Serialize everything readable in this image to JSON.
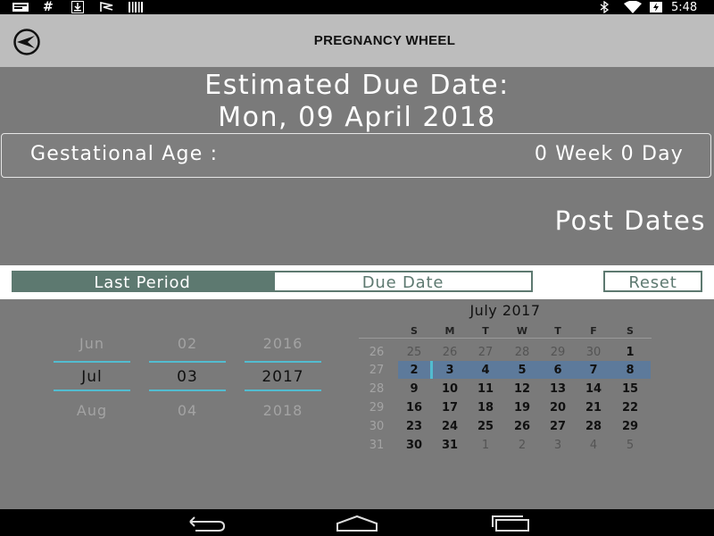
{
  "status_bar": {
    "time": "5:48",
    "left_icons": [
      "message-icon",
      "hash-icon",
      "download-icon",
      "flag-icon",
      "barcode-icon"
    ],
    "right_icons": [
      "bluetooth-icon",
      "wifi-icon",
      "battery-icon"
    ]
  },
  "action_bar": {
    "title": "PREGNANCY WHEEL",
    "back_icon": "back-arrow-icon"
  },
  "due": {
    "label": "Estimated Due Date:",
    "date": "Mon, 09 April 2018"
  },
  "gestation": {
    "label": "Gestational Age :",
    "value": "0 Week 0 Day"
  },
  "post_dates": "Post Dates",
  "tabs": {
    "last_period": "Last Period",
    "due_date": "Due Date",
    "reset": "Reset",
    "selected": "Last Period"
  },
  "colors": {
    "accent": "#5d7970",
    "highlight": "#5d7a9b",
    "divider": "#52bcd0"
  },
  "picker": {
    "month": {
      "prev": "Jun",
      "current": "Jul",
      "next": "Aug"
    },
    "day": {
      "prev": "02",
      "current": "03",
      "next": "04"
    },
    "year": {
      "prev": "2016",
      "current": "2017",
      "next": "2018"
    }
  },
  "calendar": {
    "title": "July 2017",
    "weekdays": [
      "S",
      "M",
      "T",
      "W",
      "T",
      "F",
      "S"
    ],
    "weeks": [
      {
        "num": "26",
        "days": [
          "25",
          "26",
          "27",
          "28",
          "29",
          "30",
          "1"
        ]
      },
      {
        "num": "27",
        "days": [
          "2",
          "3",
          "4",
          "5",
          "6",
          "7",
          "8"
        ]
      },
      {
        "num": "28",
        "days": [
          "9",
          "10",
          "11",
          "12",
          "13",
          "14",
          "15"
        ]
      },
      {
        "num": "29",
        "days": [
          "16",
          "17",
          "18",
          "19",
          "20",
          "21",
          "22"
        ]
      },
      {
        "num": "30",
        "days": [
          "23",
          "24",
          "25",
          "26",
          "27",
          "28",
          "29"
        ]
      },
      {
        "num": "31",
        "days": [
          "30",
          "31",
          "1",
          "2",
          "3",
          "4",
          "5"
        ]
      }
    ],
    "selected_day": "3"
  },
  "nav_bar": {
    "icons": [
      "back-icon",
      "home-icon",
      "recent-apps-icon"
    ]
  }
}
